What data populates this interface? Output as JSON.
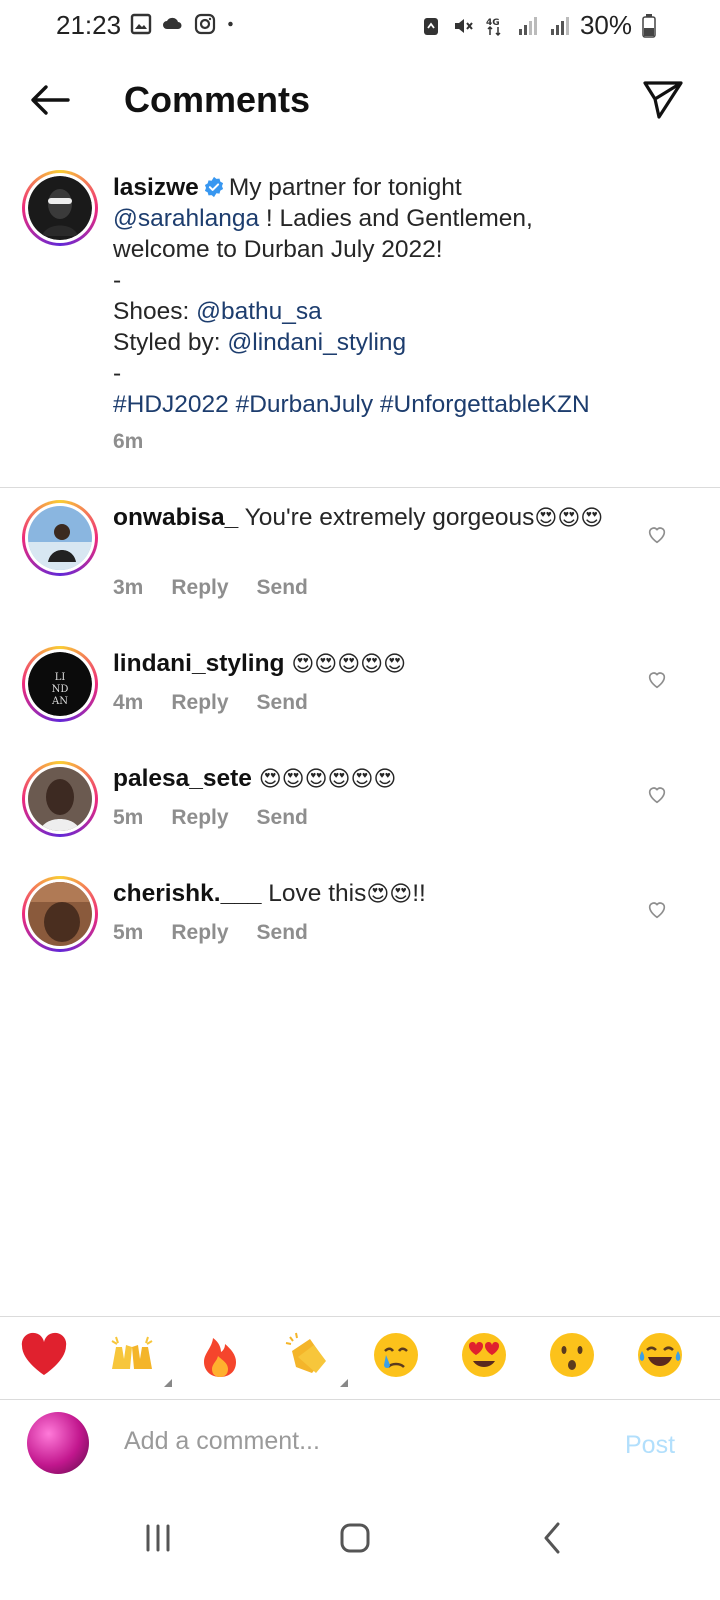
{
  "status_bar": {
    "time": "21:23",
    "battery": "30%",
    "network": "4G"
  },
  "header": {
    "title": "Comments"
  },
  "caption": {
    "username": "lasizwe",
    "verified": true,
    "segments": [
      {
        "text": "My partner for tonight ",
        "type": "text"
      },
      {
        "text": "@sarahlanga",
        "type": "mention"
      },
      {
        "text": " ! Ladies and Gentlemen, welcome to Durban July 2022!",
        "type": "text"
      },
      {
        "text": "-",
        "type": "line"
      },
      {
        "text": "Shoes: ",
        "type": "text"
      },
      {
        "text": "@bathu_sa",
        "type": "mention"
      },
      {
        "text": "Styled by: ",
        "type": "text"
      },
      {
        "text": "@lindani_styling",
        "type": "mention"
      },
      {
        "text": "-",
        "type": "line"
      },
      {
        "text": "#HDJ2022 #DurbanJuly #UnforgettableKZN",
        "type": "hashtags"
      }
    ],
    "line1_text": "My partner for tonight",
    "line2_mention": "@sarahlanga",
    "line2_text": " ! Ladies and Gentlemen,",
    "line3_text": "welcome to Durban July 2022!",
    "line4_text": "-",
    "line5_label": "Shoes: ",
    "line5_mention": "@bathu_sa",
    "line6_label": "Styled by: ",
    "line6_mention": "@lindani_styling",
    "line7_text": "-",
    "hashtags": "#HDJ2022 #DurbanJuly #UnforgettableKZN",
    "time": "6m"
  },
  "comments": [
    {
      "username": "onwabisa_",
      "text": "You're extremely gorgeous",
      "emojis": "😍😍😍",
      "time": "3m",
      "reply": "Reply",
      "send": "Send"
    },
    {
      "username": "lindani_styling",
      "text": "",
      "emojis": "😍😍😍😍😍",
      "time": "4m",
      "reply": "Reply",
      "send": "Send"
    },
    {
      "username": "palesa_sete",
      "text": "",
      "emojis": "😍😍😍😍😍😍",
      "time": "5m",
      "reply": "Reply",
      "send": "Send"
    },
    {
      "username": "cherishk.___",
      "text": "Love this",
      "emojis": "😍😍",
      "suffix": "!!",
      "time": "5m",
      "reply": "Reply",
      "send": "Send"
    }
  ],
  "reactions": [
    "red-heart",
    "raising-hands",
    "fire",
    "clapping-hands",
    "crying-face",
    "heart-eyes-face",
    "surprised-face",
    "tears-of-joy-face"
  ],
  "composer": {
    "placeholder": "Add a comment...",
    "post_label": "Post"
  },
  "colors": {
    "link": "#1d3d6e",
    "muted": "#8e8e8e",
    "post_disabled": "#b2dffc",
    "verified": "#3897f0"
  }
}
